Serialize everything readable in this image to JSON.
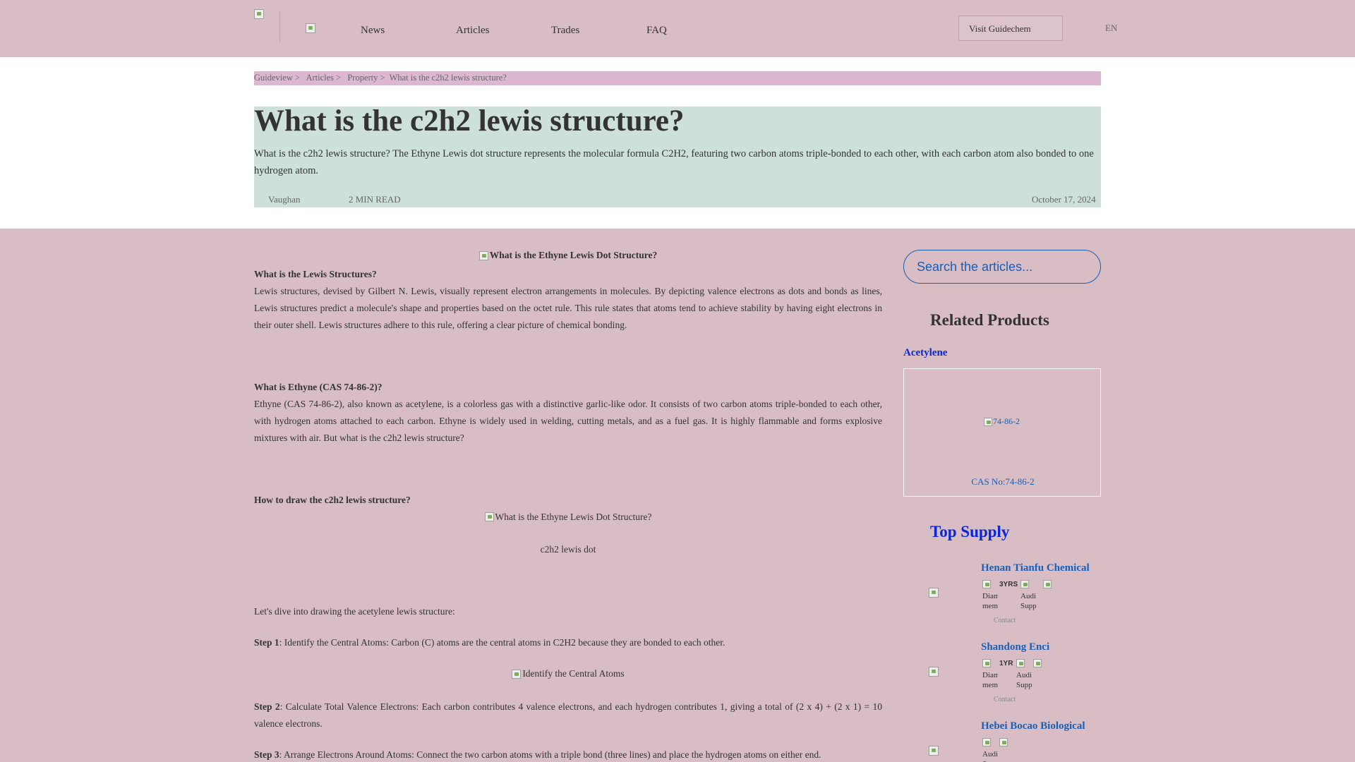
{
  "header": {
    "nav": [
      "News",
      "Articles",
      "Trades",
      "FAQ"
    ],
    "visit_button": "Visit Guidechem",
    "language": "EN"
  },
  "breadcrumb": [
    "Guideview >",
    "Articles >",
    "Property >",
    "What is the c2h2 lewis structure?"
  ],
  "article_header": {
    "title": "What is the c2h2 lewis structure?",
    "intro": "What is the c2h2 lewis structure? The Ethyne Lewis dot structure represents the molecular formula C2H2, featuring two carbon atoms triple-bonded to each other, with each carbon atom also bonded to one hydrogen atom.",
    "author": "Vaughan",
    "read_time": "2 MIN READ",
    "date": "October 17, 2024"
  },
  "article": {
    "img1_alt": "What is the Ethyne Lewis Dot Structure?",
    "h1": "What is the Lewis Structures?",
    "p1": "Lewis structures, devised by Gilbert N. Lewis, visually represent electron arrangements in molecules. By depicting valence electrons as dots and bonds as lines, Lewis structures predict a molecule's shape and properties based on the octet rule. This rule states that atoms tend to achieve stability by having eight electrons in their outer shell. Lewis structures adhere to this rule, offering a clear picture of chemical bonding.",
    "h2": "What is Ethyne (CAS 74-86-2)?",
    "p2": "Ethyne (CAS 74-86-2), also known as acetylene, is a colorless gas with a distinctive garlic-like odor. It consists of two carbon atoms triple-bonded to each other, with hydrogen atoms attached to each carbon. Ethyne is widely used in welding, cutting metals, and as a fuel gas. It is highly flammable and forms explosive mixtures with air. But what is the c2h2 lewis structure?",
    "h3": "How to draw the c2h2 lewis structure?",
    "img2_alt": "What is the Ethyne Lewis Dot Structure?",
    "img2_caption": "c2h2 lewis dot",
    "p3": "Let's dive into drawing the acetylene lewis structure:",
    "step1_label": "Step 1",
    "step1_text": ": Identify the Central Atoms: Carbon (C) atoms are the central atoms in C2H2 because they are bonded to each other.",
    "img3_alt": "Identify the Central Atoms",
    "step2_label": "Step 2",
    "step2_text": ": Calculate Total Valence Electrons: Each carbon contributes 4 valence electrons, and each hydrogen contributes 1, giving a total of (2 x 4) + (2 x 1) = 10 valence electrons.",
    "step3_label": "Step 3",
    "step3_text": ": Arrange Electrons Around Atoms: Connect the two carbon atoms with a triple bond (three lines) and place the hydrogen atoms on either end."
  },
  "sidebar": {
    "search_placeholder": "Search the articles...",
    "related_title": "Related Products",
    "product_name": "Acetylene",
    "product_img_alt": "74-86-2",
    "product_cas": "CAS No:74-86-2",
    "top_supply_title": "Top Supply",
    "suppliers": [
      {
        "name": "Henan Tianfu Chemical",
        "badges": [
          "Diamond member",
          "3YRS",
          "Audited Supplier"
        ],
        "contact": "Contact"
      },
      {
        "name": "Shandong Enci",
        "badges": [
          "Diamond member",
          "1YR",
          "Audited Supplier"
        ],
        "contact": "Contact"
      },
      {
        "name": "Hebei Bocao Biological",
        "badges": [
          "Audited Supplier"
        ],
        "contact": ""
      }
    ]
  }
}
